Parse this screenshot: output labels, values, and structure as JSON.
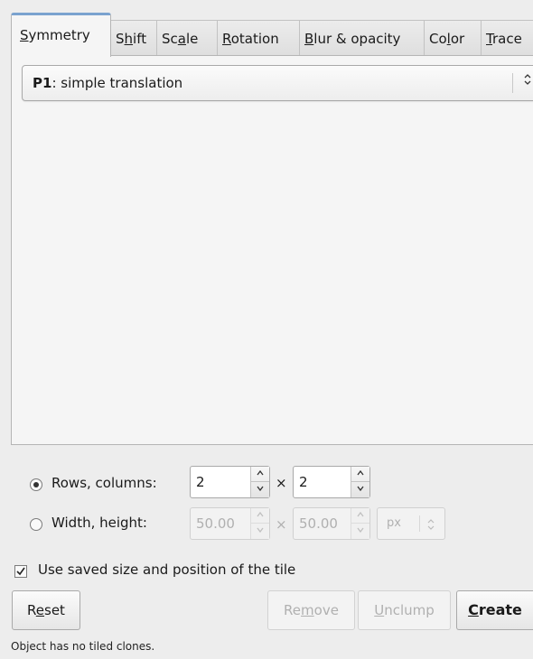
{
  "tabs": [
    {
      "pre": "",
      "mn": "S",
      "post": "ymmetry"
    },
    {
      "pre": "S",
      "mn": "h",
      "post": "ift"
    },
    {
      "pre": "Sc",
      "mn": "a",
      "post": "le"
    },
    {
      "pre": "",
      "mn": "R",
      "post": "otation"
    },
    {
      "pre": "",
      "mn": "B",
      "post": "lur & opacity"
    },
    {
      "pre": "Co",
      "mn": "l",
      "post": "or"
    },
    {
      "pre": "",
      "mn": "T",
      "post": "race"
    }
  ],
  "symmetry": {
    "selected_bold": "P1",
    "selected_rest": ": simple translation",
    "arrows": "⌃⌄"
  },
  "rows_columns": {
    "label": "Rows, columns:",
    "rows": "2",
    "columns": "2",
    "times": "×",
    "selected": true
  },
  "width_height": {
    "label": "Width, height:",
    "width": "50.00",
    "height": "50.00",
    "times": "×",
    "unit": "px",
    "selected": false
  },
  "use_saved": {
    "label": "Use saved size and position of the tile",
    "checked": "☑"
  },
  "buttons": {
    "reset": {
      "pre": "R",
      "mn": "e",
      "post": "set"
    },
    "remove": {
      "pre": "Re",
      "mn": "m",
      "post": "ove"
    },
    "unclump": {
      "pre": "",
      "mn": "U",
      "post": "nclump"
    },
    "create": {
      "pre": "",
      "mn": "C",
      "post": "reate"
    }
  },
  "status": "Object has no tiled clones."
}
